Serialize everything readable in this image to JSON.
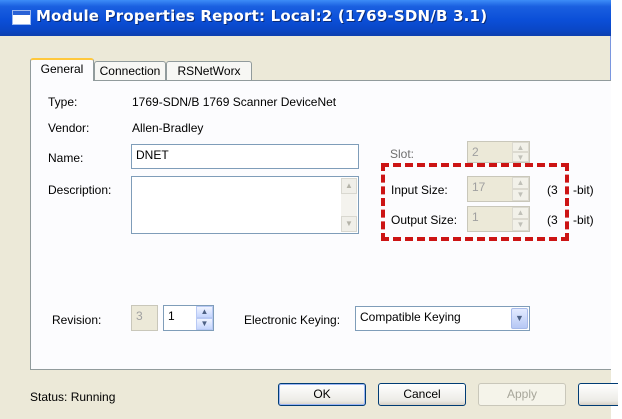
{
  "window": {
    "title": "Module Properties Report: Local:2 (1769-SDN/B 3.1)"
  },
  "tabs": [
    {
      "label": "General",
      "active": true
    },
    {
      "label": "Connection",
      "active": false
    },
    {
      "label": "RSNetWorx",
      "active": false
    }
  ],
  "general": {
    "type_label": "Type:",
    "type_value": "1769-SDN/B 1769 Scanner DeviceNet",
    "vendor_label": "Vendor:",
    "vendor_value": "Allen-Bradley",
    "name_label": "Name:",
    "name_value": "DNET",
    "description_label": "Description:",
    "description_value": "",
    "slot_label": "Slot:",
    "slot_value": "2",
    "input_size_label": "Input Size:",
    "input_size_value": "17",
    "input_size_unit": "(3",
    "input_size_unit_tail": "-bit)",
    "output_size_label": "Output Size:",
    "output_size_value": "1",
    "output_size_unit": "(3",
    "output_size_unit_tail": "-bit)",
    "revision_label": "Revision:",
    "revision_major": "3",
    "revision_minor": "1",
    "keying_label": "Electronic Keying:",
    "keying_value": "Compatible Keying"
  },
  "status": {
    "text": "Status:  Running"
  },
  "buttons": {
    "ok": "OK",
    "cancel": "Cancel",
    "apply": "Apply"
  },
  "annotation": {
    "highlight_color": "#cc1414"
  }
}
